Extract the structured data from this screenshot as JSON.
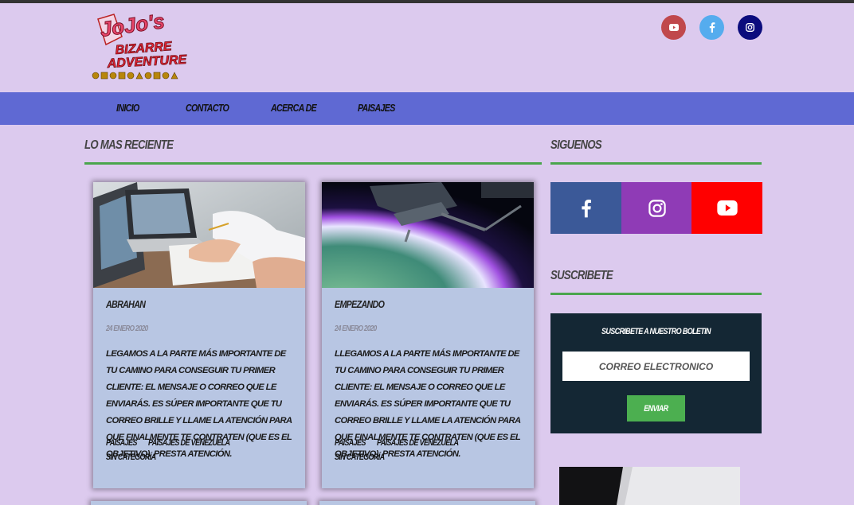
{
  "header": {
    "logo_text": [
      "JoJo's",
      "BIZARRE",
      "ADVENTURE"
    ],
    "social": [
      {
        "name": "youtube",
        "icon": "youtube-icon",
        "color": "#c0484c"
      },
      {
        "name": "facebook",
        "icon": "facebook-icon",
        "color": "#55acee"
      },
      {
        "name": "instagram",
        "icon": "instagram-icon",
        "color": "#0b0c7d"
      }
    ]
  },
  "nav": {
    "items": [
      "Inicio",
      "Contacto",
      "Acerca de",
      "Paisajes"
    ],
    "background": "#5f69d3"
  },
  "main": {
    "section_title": "Lo mas reciente",
    "posts": [
      {
        "title": "Abrahan",
        "date": "24 enero 2020",
        "excerpt": "legamos a la parte más importante de tu camino para conseguir tu primer cliente: el mensaje o correo que le enviarás. Es súper importante que tu correo brille y llame la atención para que finalmente te contraten (que es el objetivo). Presta atención.",
        "tags": [
          "Paisajes",
          "Paisajes de Venezuela",
          "Sin categoría"
        ],
        "image": "office-laptop-image"
      },
      {
        "title": "Empezando",
        "date": "24 enero 2020",
        "excerpt": "llegamos a la parte más importante de tu camino para conseguir tu primer cliente: el mensaje o correo que le enviarás. Es súper importante que tu correo brille y llame la atención para que finalmente te contraten (que es el objetivo). Presta atención.",
        "tags": [
          "Paisajes",
          "Paisajes de Venezuela",
          "Sin categoría"
        ],
        "image": "space-station-earth-image"
      }
    ]
  },
  "sidebar": {
    "follow_title": "Siguenos",
    "follow_tiles": [
      {
        "name": "facebook",
        "icon": "facebook-icon",
        "color": "#3b5998"
      },
      {
        "name": "instagram",
        "icon": "instagram-icon",
        "color": "#8f3bb6"
      },
      {
        "name": "youtube",
        "icon": "youtube-icon",
        "color": "#ff0000"
      }
    ],
    "subscribe_title": "Suscribete",
    "newsletter": {
      "label": "Suscribete a nuestro boletin",
      "placeholder": "Correo Electronico",
      "button": "Enviar"
    }
  },
  "colors": {
    "page_bg": "#dccaee",
    "accent_line": "#4aa54d",
    "card_bg": "#b8c6e3",
    "newsletter_bg": "#142734"
  }
}
